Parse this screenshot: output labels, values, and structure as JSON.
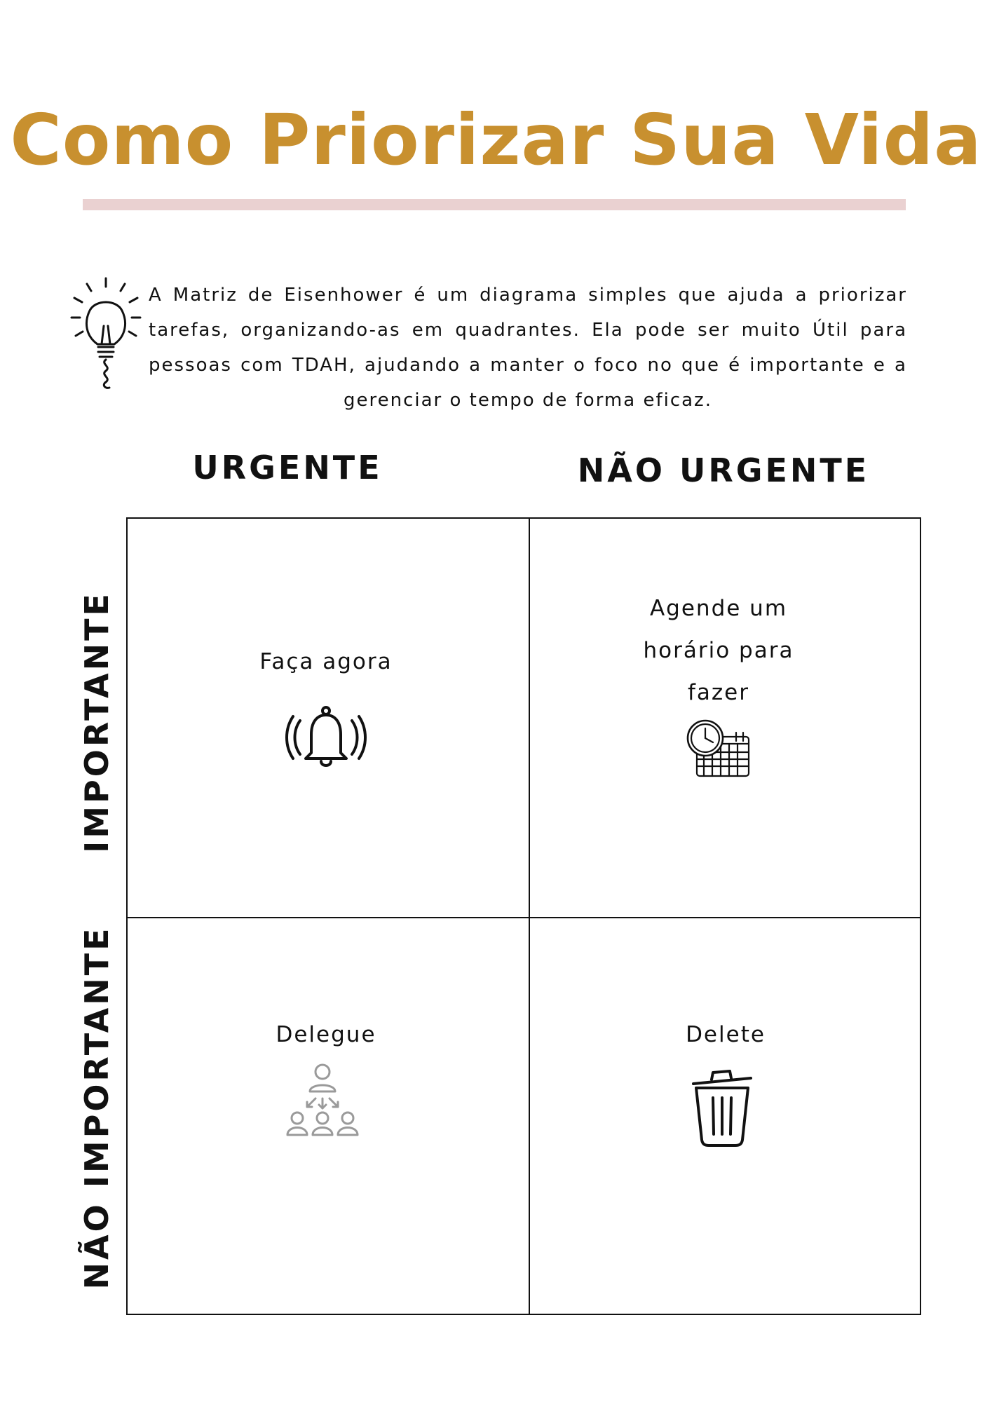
{
  "title": "Como Priorizar Sua Vida",
  "intro": "A Matriz de Eisenhower é um diagrama simples que ajuda a priorizar tarefas, organizando-as em quadrantes. Ela pode ser muito Útil para pessoas com TDAH, ajudando a manter o foco no que é importante e a gerenciar o tempo de forma eficaz.",
  "columns": {
    "urgent": "URGENTE",
    "not_urgent": "NÃO URGENTE"
  },
  "rows": {
    "important": "IMPORTANTE",
    "not_important": "NÃO IMPORTANTE"
  },
  "quadrants": {
    "do_now": "Faça agora",
    "schedule": [
      "Agende um",
      "horário para",
      "fazer"
    ],
    "delegate": "Delegue",
    "delete": "Delete"
  },
  "colors": {
    "title": "#c8902f",
    "title_rule": "#ead1d1",
    "ink": "#111111",
    "gray_icon": "#9a9a9a"
  },
  "icons": [
    "lightbulb-icon",
    "bell-icon",
    "clock-calendar-icon",
    "delegate-people-icon",
    "trash-icon"
  ]
}
